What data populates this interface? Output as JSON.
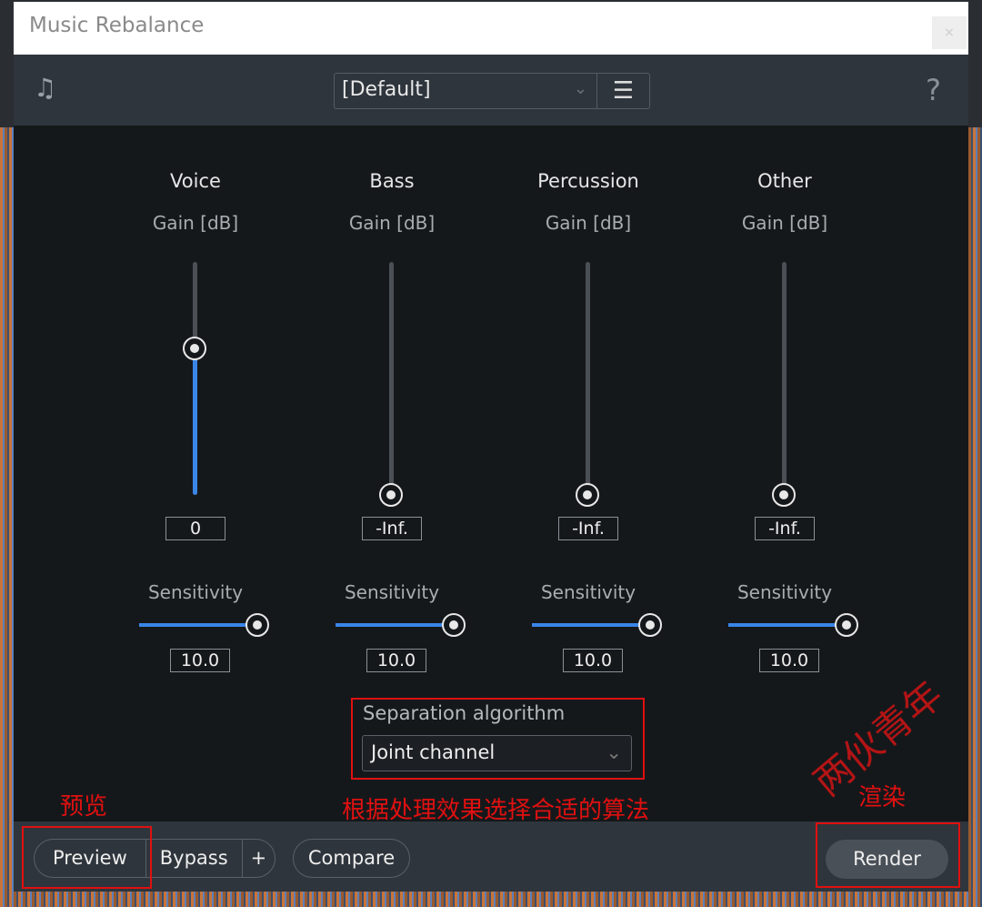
{
  "window": {
    "title": "Music Rebalance",
    "close": "×"
  },
  "toolbar": {
    "preset": "[Default]",
    "menu_icon": "hamburger-icon",
    "help": "?",
    "logo_icon": "music-note-icon"
  },
  "channels": [
    {
      "name": "Voice",
      "gain_label": "Gain [dB]",
      "gain_value": "0",
      "gain_level": 0.63,
      "sensitivity_label": "Sensitivity",
      "sensitivity_value": "10.0",
      "sensitivity_level": 1.0
    },
    {
      "name": "Bass",
      "gain_label": "Gain [dB]",
      "gain_value": "-Inf.",
      "gain_level": 0,
      "sensitivity_label": "Sensitivity",
      "sensitivity_value": "10.0",
      "sensitivity_level": 1.0
    },
    {
      "name": "Percussion",
      "gain_label": "Gain [dB]",
      "gain_value": "-Inf.",
      "gain_level": 0,
      "sensitivity_label": "Sensitivity",
      "sensitivity_value": "10.0",
      "sensitivity_level": 1.0
    },
    {
      "name": "Other",
      "gain_label": "Gain [dB]",
      "gain_value": "-Inf.",
      "gain_level": 0,
      "sensitivity_label": "Sensitivity",
      "sensitivity_value": "10.0",
      "sensitivity_level": 1.0
    }
  ],
  "algorithm": {
    "label": "Separation algorithm",
    "value": "Joint channel"
  },
  "footer": {
    "preview": "Preview",
    "bypass": "Bypass",
    "plus": "+",
    "compare": "Compare",
    "render": "Render"
  },
  "annotations": {
    "preview": "预览",
    "algorithm": "根据处理效果选择合适的算法",
    "render": "渲染"
  },
  "watermark": "两伙青年",
  "colors": {
    "accent": "#3a86e8",
    "annotation": "#e01010"
  }
}
